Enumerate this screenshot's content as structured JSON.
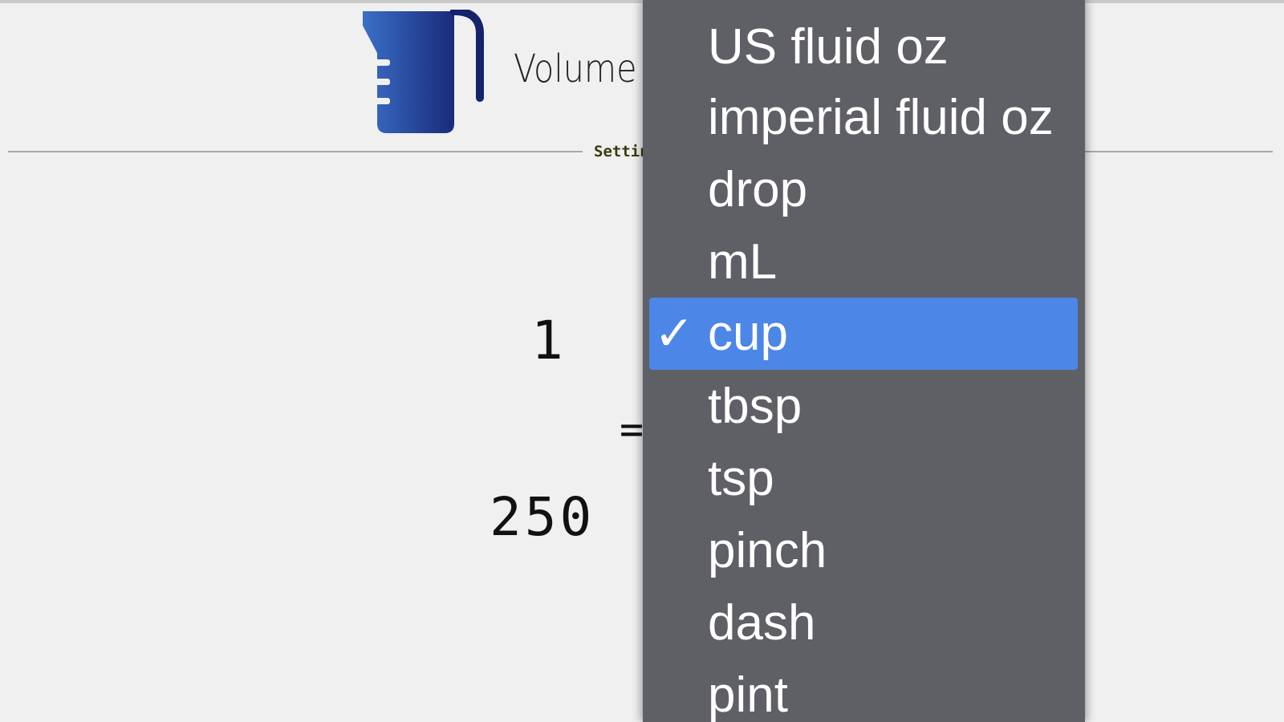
{
  "app": {
    "title": "Volume",
    "settings_label": "Settings"
  },
  "converter": {
    "from_value": "1",
    "equals_sign": "=",
    "to_value": "250"
  },
  "unit_menu": {
    "selected": "cup",
    "check_glyph": "✓",
    "items": [
      {
        "label": "US fluid oz"
      },
      {
        "label": "imperial fluid oz"
      },
      {
        "label": "drop"
      },
      {
        "label": "mL"
      },
      {
        "label": "cup"
      },
      {
        "label": "tbsp"
      },
      {
        "label": "tsp"
      },
      {
        "label": "pinch"
      },
      {
        "label": "dash"
      },
      {
        "label": "pint"
      }
    ]
  },
  "colors": {
    "background": "#f0f0f0",
    "menu_background": "#5f5f66",
    "menu_highlight": "#4c86e6",
    "logo_gradient_start": "#3a6fc7",
    "logo_gradient_end": "#1a2a7a",
    "logo_handle": "#15236d"
  },
  "icons": {
    "logo": "measuring-cup-icon",
    "selected_marker": "checkmark-icon"
  }
}
